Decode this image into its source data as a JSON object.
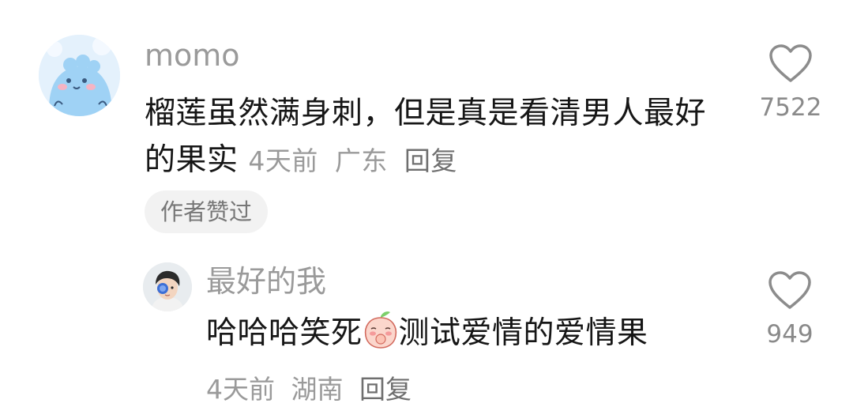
{
  "comments": [
    {
      "user": "momo",
      "avatar_icon": "blue-cartoon-avatar",
      "text_before_emoji": "榴莲虽然满身刺，但是真是看清男人最好的果实",
      "time": "4天前",
      "location": "广东",
      "reply_label": "回复",
      "badge": "作者赞过",
      "likes": "7522"
    },
    {
      "user": "最好的我",
      "avatar_icon": "boy-photo-avatar",
      "text_before_emoji": "哈哈哈笑死",
      "emoji": "peach-shy-emoji",
      "text_after_emoji": "测试爱情的爱情果",
      "time": "4天前",
      "location": "湖南",
      "reply_label": "回复",
      "likes": "949"
    }
  ],
  "colors": {
    "username": "#9a9a9a",
    "text": "#161616",
    "meta": "#9a9a9a",
    "badge_bg": "#f2f2f2"
  }
}
